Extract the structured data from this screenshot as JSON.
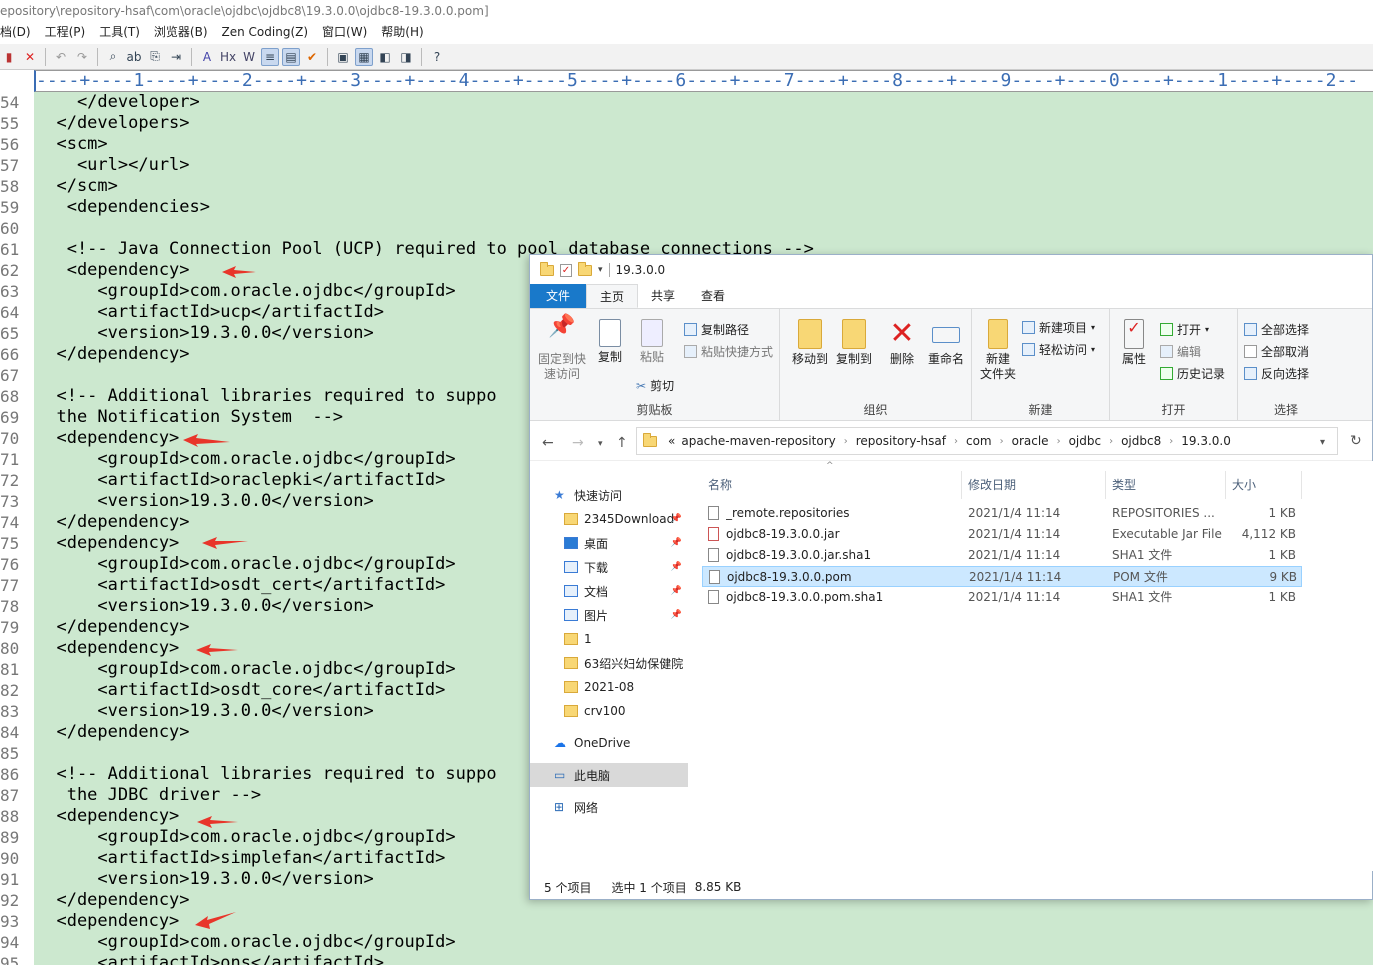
{
  "editor": {
    "title": "epository\\repository-hsaf\\com\\oracle\\ojdbc\\ojdbc8\\19.3.0.0\\ojdbc8-19.3.0.0.pom]",
    "menu": [
      "档(D)",
      "工程(P)",
      "工具(T)",
      "浏览器(B)",
      "Zen Coding(Z)",
      "窗口(W)",
      "帮助(H)"
    ],
    "ruler": "----+----1----+----2----+----3----+----4----+----5----+----6----+----7----+----8----+----9----+----0----+----1----+----2--",
    "line_numbers": [
      "54",
      "55",
      "56",
      "57",
      "58",
      "59",
      "60",
      "61",
      "62",
      "63",
      "64",
      "65",
      "66",
      "67",
      "68",
      "69",
      "70",
      "71",
      "72",
      "73",
      "74",
      "75",
      "76",
      "77",
      "78",
      "79",
      "80",
      "81",
      "82",
      "83",
      "84",
      "85",
      "86",
      "87",
      "88",
      "89",
      "90",
      "91",
      "92",
      "93",
      "94",
      "95"
    ],
    "lines": [
      "    </developer>",
      "  </developers>",
      "  <scm>",
      "    <url></url>",
      "  </scm>",
      "   <dependencies>",
      "",
      "   <!-- Java Connection Pool (UCP) required to pool database connections -->",
      "   <dependency>",
      "      <groupId>com.oracle.ojdbc</groupId>",
      "      <artifactId>ucp</artifactId>",
      "      <version>19.3.0.0</version>",
      "  </dependency>",
      "",
      "  <!-- Additional libraries required to suppo",
      "  the Notification System  -->",
      "  <dependency>",
      "      <groupId>com.oracle.ojdbc</groupId>",
      "      <artifactId>oraclepki</artifactId>",
      "      <version>19.3.0.0</version>",
      "  </dependency>",
      "  <dependency>",
      "      <groupId>com.oracle.ojdbc</groupId>",
      "      <artifactId>osdt_cert</artifactId>",
      "      <version>19.3.0.0</version>",
      "  </dependency>",
      "  <dependency>",
      "      <groupId>com.oracle.ojdbc</groupId>",
      "      <artifactId>osdt_core</artifactId>",
      "      <version>19.3.0.0</version>",
      "  </dependency>",
      "",
      "  <!-- Additional libraries required to suppo",
      "   the JDBC driver -->",
      "  <dependency>",
      "      <groupId>com.oracle.ojdbc</groupId>",
      "      <artifactId>simplefan</artifactId>",
      "      <version>19.3.0.0</version>",
      "  </dependency>",
      "  <dependency>",
      "      <groupId>com.oracle.ojdbc</groupId>",
      "      <artifactId>ons</artifactId>"
    ]
  },
  "explorer": {
    "title": "19.3.0.0",
    "tabs": [
      "文件",
      "主页",
      "共享",
      "查看"
    ],
    "ribbon": {
      "pin": "固定到快\n速访问",
      "copy": "复制",
      "paste": "粘贴",
      "copy_path": "复制路径",
      "paste_shortcut": "粘贴快捷方式",
      "cut": "剪切",
      "clipboard": "剪贴板",
      "move_to": "移动到",
      "copy_to": "复制到",
      "delete": "删除",
      "rename": "重命名",
      "organize": "组织",
      "new_folder": "新建\n文件夹",
      "new_item": "新建项目",
      "easy_access": "轻松访问",
      "new": "新建",
      "properties": "属性",
      "open": "打开",
      "edit": "编辑",
      "history": "历史记录",
      "open_group": "打开",
      "select_all": "全部选择",
      "select_none": "全部取消",
      "invert": "反向选择",
      "select_group": "选择"
    },
    "address": [
      "«",
      "apache-maven-repository",
      "repository-hsaf",
      "com",
      "oracle",
      "ojdbc",
      "ojdbc8",
      "19.3.0.0"
    ],
    "sidebar": [
      {
        "label": "快速访问",
        "pinned": false
      },
      {
        "label": "2345Download",
        "pinned": true
      },
      {
        "label": "桌面",
        "pinned": true
      },
      {
        "label": "下载",
        "pinned": true
      },
      {
        "label": "文档",
        "pinned": true
      },
      {
        "label": "图片",
        "pinned": true
      },
      {
        "label": "1",
        "pinned": false
      },
      {
        "label": "63绍兴妇幼保健院",
        "pinned": false
      },
      {
        "label": "2021-08",
        "pinned": false
      },
      {
        "label": "crv100",
        "pinned": false
      },
      {
        "label": "OneDrive",
        "pinned": false
      },
      {
        "label": "此电脑",
        "pinned": false
      },
      {
        "label": "网络",
        "pinned": false
      }
    ],
    "columns": [
      "名称",
      "修改日期",
      "类型",
      "大小"
    ],
    "files": [
      {
        "name": "_remote.repositories",
        "date": "2021/1/4 11:14",
        "type": "REPOSITORIES ...",
        "size": "1 KB"
      },
      {
        "name": "ojdbc8-19.3.0.0.jar",
        "date": "2021/1/4 11:14",
        "type": "Executable Jar File",
        "size": "4,112 KB"
      },
      {
        "name": "ojdbc8-19.3.0.0.jar.sha1",
        "date": "2021/1/4 11:14",
        "type": "SHA1 文件",
        "size": "1 KB"
      },
      {
        "name": "ojdbc8-19.3.0.0.pom",
        "date": "2021/1/4 11:14",
        "type": "POM 文件",
        "size": "9 KB"
      },
      {
        "name": "ojdbc8-19.3.0.0.pom.sha1",
        "date": "2021/1/4 11:14",
        "type": "SHA1 文件",
        "size": "1 KB"
      }
    ],
    "status": {
      "count": "5 个项目",
      "selected": "选中 1 个项目",
      "size": "8.85 KB"
    }
  }
}
